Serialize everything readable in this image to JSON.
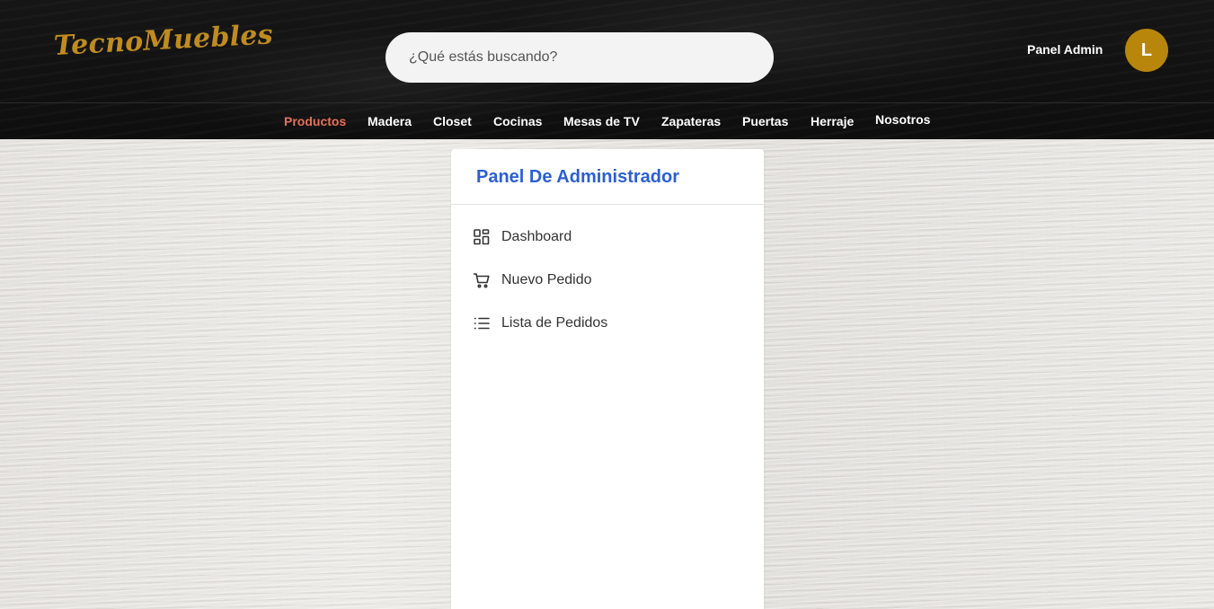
{
  "brand": {
    "logo_text": "TecnoMuebles",
    "logo_color": "#c08c20"
  },
  "search": {
    "placeholder": "¿Qué estás buscando?",
    "value": "",
    "icon": "search-icon"
  },
  "header": {
    "panel_link_label": "Panel Admin",
    "avatar_initial": "L",
    "avatar_color": "#b8860b"
  },
  "nav": {
    "items": [
      {
        "label": "Productos",
        "active": true
      },
      {
        "label": "Madera",
        "active": false
      },
      {
        "label": "Closet",
        "active": false
      },
      {
        "label": "Cocinas",
        "active": false
      },
      {
        "label": "Mesas de TV",
        "active": false
      },
      {
        "label": "Zapateras",
        "active": false
      },
      {
        "label": "Puertas",
        "active": false
      },
      {
        "label": "Herraje",
        "active": false
      },
      {
        "label": "Nosotros",
        "active": false
      }
    ],
    "active_color": "#e8705a"
  },
  "admin_panel": {
    "title": "Panel De Administrador",
    "title_color": "#2a5fd4",
    "menu": [
      {
        "label": "Dashboard",
        "icon": "dashboard-grid-icon"
      },
      {
        "label": "Nuevo Pedido",
        "icon": "cart-icon"
      },
      {
        "label": "Lista de Pedidos",
        "icon": "list-icon"
      }
    ]
  }
}
